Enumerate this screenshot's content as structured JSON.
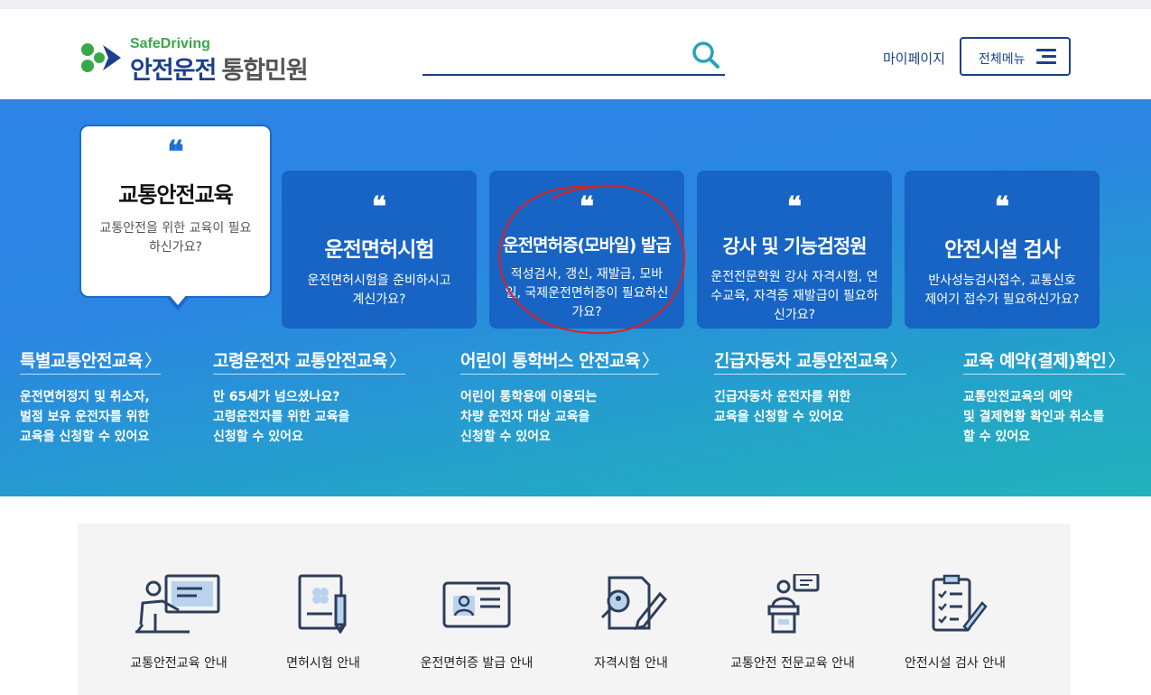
{
  "header": {
    "logo_en": "SafeDriving",
    "logo_ko_main": "안전운전",
    "logo_ko_sub": "통합민원",
    "search_placeholder": "",
    "mypage_label": "마이페이지",
    "menu_label": "전체메뉴"
  },
  "hero": {
    "callout": {
      "quote": "❝",
      "title": "교통안전교육",
      "desc": "교통안전을 위한 교육이 필요하신가요?"
    },
    "cards": [
      {
        "quote": "❝",
        "title": "운전면허시험",
        "desc": "운전면허시험을 준비하시고 계신가요?"
      },
      {
        "quote": "❝",
        "title": "운전면허증(모바일) 발급",
        "desc": "적성검사, 갱신, 재발급, 모바일, 국제운전면허증이 필요하신가요?"
      },
      {
        "quote": "❝",
        "title": "강사 및 기능검정원",
        "desc": "운전전문학원 강사 자격시험, 연수교육, 자격증 재발급이 필요하신가요?"
      },
      {
        "quote": "❝",
        "title": "안전시설 검사",
        "desc": "반사성능검사접수, 교통신호제어기 접수가 필요하신가요?"
      }
    ],
    "links": [
      {
        "title": "특별교통안전교육",
        "arrow": "〉",
        "desc": [
          "운전면허정지 및 취소자,",
          "벌점 보유 운전자를 위한",
          "교육을 신청할 수 있어요"
        ]
      },
      {
        "title": "고령운전자 교통안전교육",
        "arrow": "〉",
        "desc": [
          "만 65세가 넘으셨나요?",
          "고령운전자를 위한 교육을",
          "신청할 수 있어요"
        ]
      },
      {
        "title": "어린이 통학버스 안전교육",
        "arrow": "〉",
        "desc": [
          "어린이 통학용에 이용되는",
          "차량 운전자 대상 교육을",
          "신청할 수 있어요"
        ]
      },
      {
        "title": "긴급자동차 교통안전교육",
        "arrow": "〉",
        "desc": [
          "긴급자동차 운전자를 위한",
          "교육을 신청할 수 있어요"
        ]
      },
      {
        "title": "교육 예약(결제)확인",
        "arrow": "〉",
        "desc": [
          "교통안전교육의 예약",
          "및 결제현황 확인과 취소를",
          "할 수 있어요"
        ]
      }
    ]
  },
  "services": [
    {
      "label": "교통안전교육 안내",
      "icon": "lecture-icon"
    },
    {
      "label": "면허시험 안내",
      "icon": "document-pen-icon"
    },
    {
      "label": "운전면허증 발급 안내",
      "icon": "id-card-icon"
    },
    {
      "label": "자격시험 안내",
      "icon": "exam-icon"
    },
    {
      "label": "교통안전 전문교육 안내",
      "icon": "podium-icon"
    },
    {
      "label": "안전시설 검사 안내",
      "icon": "checklist-icon"
    }
  ],
  "colors": {
    "brand_navy": "#1b3f8b",
    "brand_green": "#39a849",
    "card_blue": "#1764c4",
    "annotation_red": "#e02020"
  }
}
